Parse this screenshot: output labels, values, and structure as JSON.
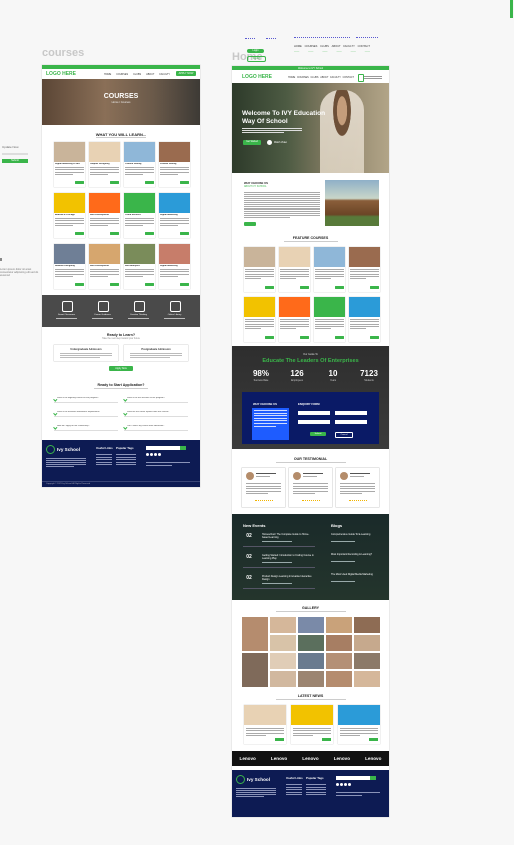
{
  "canvas": {
    "courses_label": "courses",
    "home_label": "Home",
    "side_label": "Update Now",
    "side_button": "Submit",
    "side_note": "Lorem ipsum dolor sit amet consectetur adipiscing elit sed do eiusmod"
  },
  "colors": {
    "green": "#3ab54a",
    "navy": "#0d1b53",
    "dark": "#2b2b2b",
    "blue_panel": "#0a2a86"
  },
  "courses_page": {
    "logo": "LOGO HERE",
    "nav": [
      "HOME",
      "COURSES",
      "CLUBS",
      "ABOUT",
      "FACULTY",
      "CONTACT"
    ],
    "cta": "APPLY NOW",
    "hero_title": "COURSES",
    "hero_sub": "Home / Courses",
    "learn_title": "WHAT YOU WILL LEARN...",
    "courses": [
      {
        "title": "Digital Marketing & SEO"
      },
      {
        "title": "Graphic Designing"
      },
      {
        "title": "Content Writing"
      },
      {
        "title": "Product Writing"
      },
      {
        "title": "Android & IOS App"
      },
      {
        "title": "Web Development"
      },
      {
        "title": "Cloud Services"
      },
      {
        "title": "Digital Marketing"
      },
      {
        "title": "Network Designing"
      },
      {
        "title": "Web Development"
      },
      {
        "title": "Web Analytics"
      },
      {
        "title": "Digital Marketing"
      }
    ],
    "features": [
      "Smart Classroom",
      "Career Guidance",
      "Creative Thinking",
      "Online Library"
    ],
    "ready_title": "Ready to Learn?",
    "ready_sub": "Take the next step toward your future",
    "boxes": [
      "Undergraduate Admission",
      "Postgraduate Admission"
    ],
    "apply_btn": "Apply Now",
    "faq_title": "Ready to Start Application?",
    "faq": [
      "What is the eligibility criteria for the program?",
      "What is the fee structure of the program?",
      "What is the minimum attendance requirement?",
      "What are the career options after this course?",
      "How do I apply for the scholarship?",
      "Can I switch my course after admission?"
    ],
    "footer_logo": "Ivy School",
    "footer_cols": [
      "Useful Links",
      "Popular Tags"
    ],
    "copyright": "Copyright © 2023 Ivy School. All Rights Reserved"
  },
  "home_page": {
    "topbar": "Welcome to IVY School",
    "logo": "LOGO HERE",
    "nav": [
      "HOME",
      "COURSES",
      "CLUBS",
      "ABOUT",
      "FACULTY",
      "CONTACT"
    ],
    "hero_title": "Welcome To IVY Education Way Of School",
    "hero_btn": "Get Started",
    "hero_play": "Watch Video",
    "about_title": "WHY CHOOSE US",
    "about_sub": "ABOUT IVY SCHOOL",
    "featured_title": "FEATURE COURSES",
    "stats_small": "Our Guide To",
    "stats_title": "Educate The Leaders Of Enterprises",
    "stats": [
      {
        "value": "98%",
        "label": "Success Rate"
      },
      {
        "value": "126",
        "label": "Employees"
      },
      {
        "value": "10",
        "label": "Years"
      },
      {
        "value": "7123",
        "label": "Students"
      }
    ],
    "why_title": "WHY CHOOSE US",
    "enquiry_title": "ENQUIRY FORM",
    "enquiry_buttons": [
      "Submit",
      "Cancel"
    ],
    "testimonial_title": "OUR TESTIMONIAL",
    "events_title": "New Events",
    "blogs_title": "Blogs",
    "events": [
      {
        "day": "02",
        "title": "Homeschool: The Complete Guide to Home-based Learning"
      },
      {
        "day": "02",
        "title": "Getting Started: Introduction to Coding Course in Learning Play"
      },
      {
        "day": "02",
        "title": "Product Design Learning Innovative Interactive Design"
      }
    ],
    "blogs": [
      "Comprehensive Guide To E-Learning",
      "Most Important Recording & Learning?",
      "The Most Used Digital Media Marketing"
    ],
    "gallery_title": "GALLERY",
    "news_title": "LATEST NEWS",
    "sponsors": [
      "Lenovo",
      "Lenovo",
      "Lenovo",
      "Lenovo",
      "Lenovo"
    ],
    "footer_logo": "Ivy School",
    "footer_cols": [
      "Useful Links",
      "Popular Tags"
    ]
  },
  "toolbar": {
    "items": [
      "Login",
      "Signup"
    ],
    "menu": [
      "HOME",
      "COURSES",
      "CLUBS",
      "ABOUT",
      "FACULTY",
      "CONTACT"
    ]
  }
}
